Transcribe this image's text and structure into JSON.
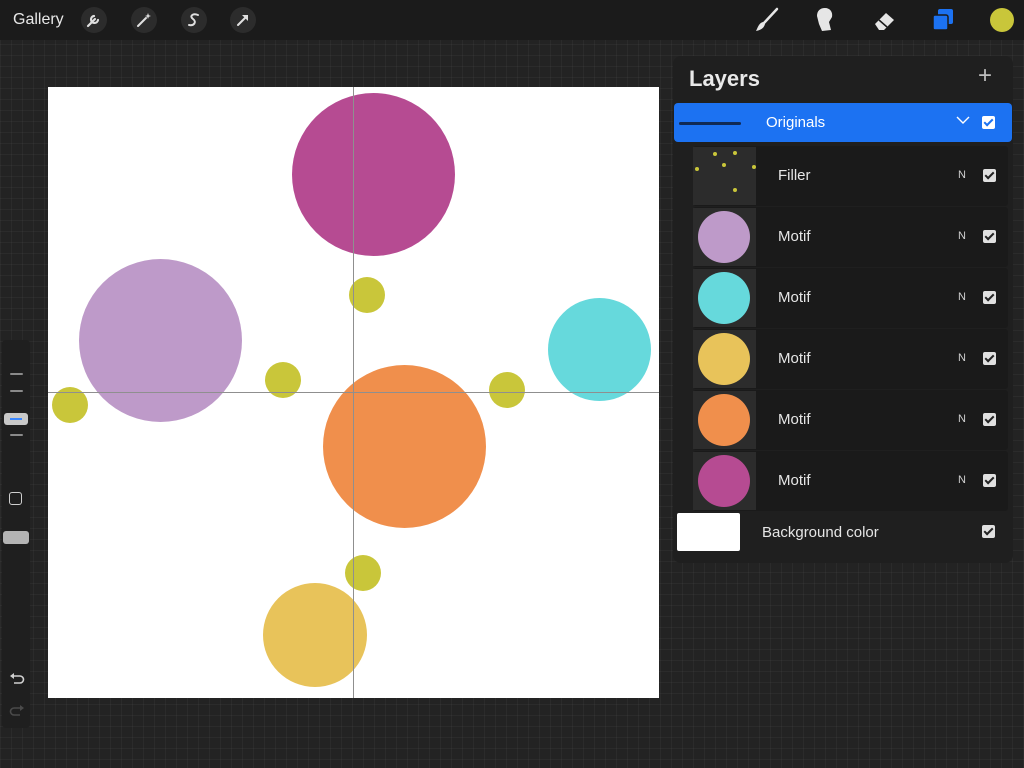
{
  "toolbar": {
    "gallery_label": "Gallery",
    "left_tools": [
      "wrench-icon",
      "magic-wand-icon",
      "selection-s-icon",
      "transform-arrow-icon"
    ],
    "right_tools": [
      "brush-icon",
      "smudge-icon",
      "eraser-icon",
      "layers-icon"
    ],
    "current_color": "#c9c63a"
  },
  "canvas": {
    "background": "#ffffff",
    "guide_color": "#8f8f8f",
    "shapes": [
      {
        "name": "magenta-circle",
        "color": "#b64b92"
      },
      {
        "name": "lavender-circle",
        "color": "#be9ac9"
      },
      {
        "name": "cyan-circle",
        "color": "#66d9dc"
      },
      {
        "name": "orange-circle",
        "color": "#f08f4c"
      },
      {
        "name": "yellow-circle",
        "color": "#e8c35a"
      },
      {
        "name": "filler-dot",
        "color": "#c9c63a"
      }
    ]
  },
  "layers": {
    "title": "Layers",
    "add_symbol": "+",
    "group": {
      "label": "Originals",
      "visible": true,
      "color": "#1c72f2"
    },
    "items": [
      {
        "label": "Filler",
        "blend": "N",
        "visible": true,
        "thumb": "dots",
        "color": "#c9c63a"
      },
      {
        "label": "Motif",
        "blend": "N",
        "visible": true,
        "thumb": "circle",
        "color": "#be9ac9"
      },
      {
        "label": "Motif",
        "blend": "N",
        "visible": true,
        "thumb": "circle",
        "color": "#66d9dc"
      },
      {
        "label": "Motif",
        "blend": "N",
        "visible": true,
        "thumb": "circle",
        "color": "#e8c35a"
      },
      {
        "label": "Motif",
        "blend": "N",
        "visible": true,
        "thumb": "circle",
        "color": "#f08f4c"
      },
      {
        "label": "Motif",
        "blend": "N",
        "visible": true,
        "thumb": "circle",
        "color": "#b64b92"
      }
    ],
    "background": {
      "label": "Background color",
      "color": "#ffffff",
      "visible": true
    }
  }
}
